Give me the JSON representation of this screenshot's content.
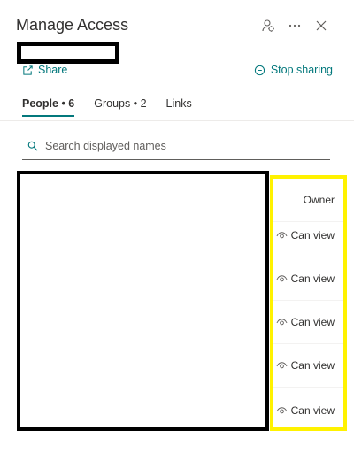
{
  "header": {
    "title": "Manage Access",
    "icons": [
      "share-settings-icon",
      "more-icon",
      "close-icon"
    ]
  },
  "share": {
    "label": "Share",
    "icon": "share-icon"
  },
  "stop_sharing": {
    "label": "Stop sharing",
    "icon": "stop-icon"
  },
  "tabs": [
    {
      "label": "People • 6",
      "active": true
    },
    {
      "label": "Groups • 2",
      "active": false
    },
    {
      "label": "Links",
      "active": false
    }
  ],
  "search": {
    "placeholder": "Search displayed names",
    "value": ""
  },
  "permissions": [
    {
      "label": "Owner",
      "icon": ""
    },
    {
      "label": "Can view",
      "icon": "eye-icon"
    },
    {
      "label": "Can view",
      "icon": "eye-icon"
    },
    {
      "label": "Can view",
      "icon": "eye-icon"
    },
    {
      "label": "Can view",
      "icon": "eye-icon"
    },
    {
      "label": "Can view",
      "icon": "eye-icon"
    }
  ],
  "colors": {
    "accent": "#03787c",
    "redaction": "#000000",
    "highlight": "#fff200"
  }
}
